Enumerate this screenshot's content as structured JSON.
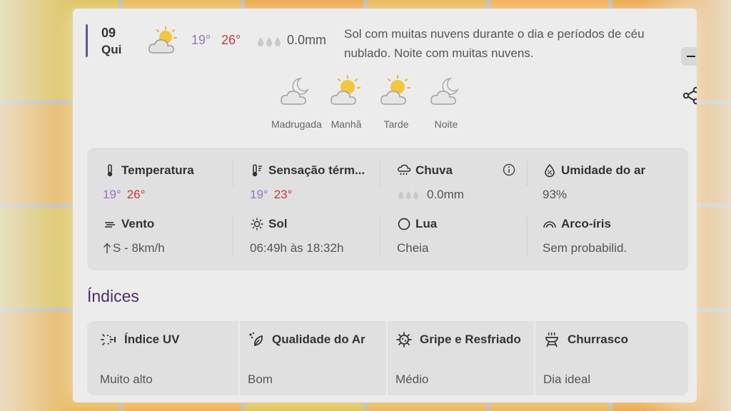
{
  "day": {
    "number": "09",
    "weekday": "Qui",
    "temp_min": "19°",
    "temp_max": "26°",
    "rain": "0.0mm",
    "description": "Sol com muitas nuvens durante o dia e períodos de céu nublado. Noite com muitas nuvens."
  },
  "periods": [
    {
      "label": "Madrugada",
      "icon": "moon-cloud-icon"
    },
    {
      "label": "Manhã",
      "icon": "sun-cloud-icon"
    },
    {
      "label": "Tarde",
      "icon": "sun-cloud-icon"
    },
    {
      "label": "Noite",
      "icon": "moon-cloud-icon"
    }
  ],
  "details": {
    "temperature": {
      "title": "Temperatura",
      "min": "19°",
      "max": "26°"
    },
    "feels_like": {
      "title": "Sensação térm...",
      "min": "19°",
      "max": "23°"
    },
    "rain": {
      "title": "Chuva",
      "value": "0.0mm"
    },
    "humidity": {
      "title": "Umidade do ar",
      "value": "93%"
    },
    "wind": {
      "title": "Vento",
      "value": "S - 8km/h"
    },
    "sun": {
      "title": "Sol",
      "value": "06:49h às 18:32h"
    },
    "moon": {
      "title": "Lua",
      "value": "Cheia"
    },
    "rainbow": {
      "title": "Arco-íris",
      "value": "Sem probabilid."
    }
  },
  "indices": {
    "title": "Índices",
    "items": [
      {
        "label": "Índice UV",
        "value": "Muito alto"
      },
      {
        "label": "Qualidade do Ar",
        "value": "Bom"
      },
      {
        "label": "Gripe e Resfriado",
        "value": "Médio"
      },
      {
        "label": "Churrasco",
        "value": "Dia ideal"
      }
    ]
  },
  "colors": {
    "min": "#9a72c4",
    "max": "#c23a3a",
    "heading": "#4b2f5e"
  }
}
